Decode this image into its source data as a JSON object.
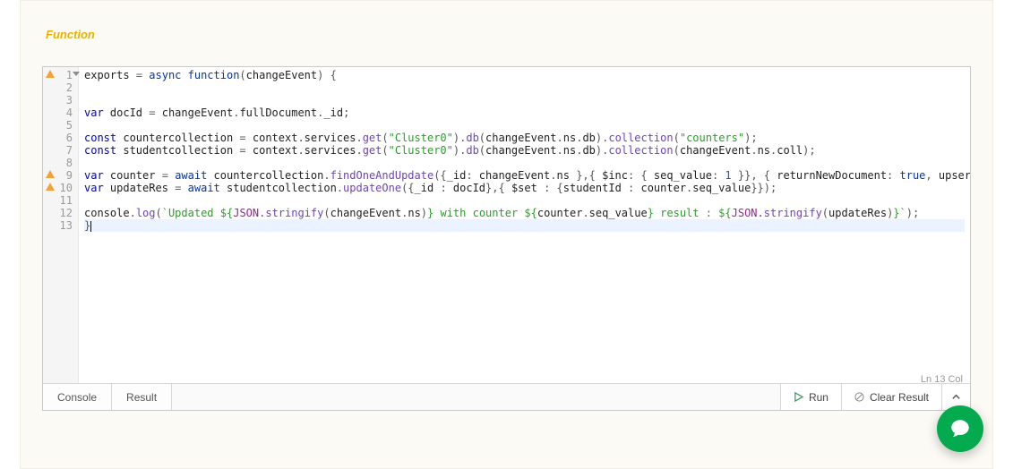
{
  "section_title": "Function",
  "tabs": {
    "console": "Console",
    "result": "Result"
  },
  "buttons": {
    "run": "Run",
    "clear": "Clear Result"
  },
  "status": "Ln 13 Col",
  "editor": {
    "active_line": 13,
    "lines": [
      {
        "n": 1,
        "warn": true,
        "fold": true,
        "tokens": [
          [
            "ident",
            "exports"
          ],
          [
            "op",
            " = "
          ],
          [
            "kw2",
            "async"
          ],
          [
            "ident",
            " "
          ],
          [
            "kw2",
            "function"
          ],
          [
            "punc",
            "("
          ],
          [
            "ident",
            "changeEvent"
          ],
          [
            "punc",
            ")"
          ],
          [
            "ident",
            " "
          ],
          [
            "punc",
            "{"
          ]
        ]
      },
      {
        "n": 2,
        "tokens": []
      },
      {
        "n": 3,
        "tokens": []
      },
      {
        "n": 4,
        "tokens": [
          [
            "storage",
            "var"
          ],
          [
            "ident",
            " docId "
          ],
          [
            "op",
            "="
          ],
          [
            "ident",
            " changeEvent"
          ],
          [
            "punc",
            "."
          ],
          [
            "ident",
            "fullDocument"
          ],
          [
            "punc",
            "."
          ],
          [
            "ident",
            "_id"
          ],
          [
            "punc",
            ";"
          ]
        ]
      },
      {
        "n": 5,
        "tokens": []
      },
      {
        "n": 6,
        "tokens": [
          [
            "storage",
            "const"
          ],
          [
            "ident",
            " countercollection "
          ],
          [
            "op",
            "="
          ],
          [
            "ident",
            " context"
          ],
          [
            "punc",
            "."
          ],
          [
            "ident",
            "services"
          ],
          [
            "punc",
            "."
          ],
          [
            "func",
            "get"
          ],
          [
            "punc",
            "("
          ],
          [
            "str",
            "\"Cluster0\""
          ],
          [
            "punc",
            ")"
          ],
          [
            "punc",
            "."
          ],
          [
            "func",
            "db"
          ],
          [
            "punc",
            "("
          ],
          [
            "ident",
            "changeEvent"
          ],
          [
            "punc",
            "."
          ],
          [
            "ident",
            "ns"
          ],
          [
            "punc",
            "."
          ],
          [
            "ident",
            "db"
          ],
          [
            "punc",
            ")"
          ],
          [
            "punc",
            "."
          ],
          [
            "func",
            "collection"
          ],
          [
            "punc",
            "("
          ],
          [
            "str",
            "\"counters\""
          ],
          [
            "punc",
            ")"
          ],
          [
            "punc",
            ";"
          ]
        ]
      },
      {
        "n": 7,
        "tokens": [
          [
            "storage",
            "const"
          ],
          [
            "ident",
            " studentcollection "
          ],
          [
            "op",
            "="
          ],
          [
            "ident",
            " context"
          ],
          [
            "punc",
            "."
          ],
          [
            "ident",
            "services"
          ],
          [
            "punc",
            "."
          ],
          [
            "func",
            "get"
          ],
          [
            "punc",
            "("
          ],
          [
            "str",
            "\"Cluster0\""
          ],
          [
            "punc",
            ")"
          ],
          [
            "punc",
            "."
          ],
          [
            "func",
            "db"
          ],
          [
            "punc",
            "("
          ],
          [
            "ident",
            "changeEvent"
          ],
          [
            "punc",
            "."
          ],
          [
            "ident",
            "ns"
          ],
          [
            "punc",
            "."
          ],
          [
            "ident",
            "db"
          ],
          [
            "punc",
            ")"
          ],
          [
            "punc",
            "."
          ],
          [
            "func",
            "collection"
          ],
          [
            "punc",
            "("
          ],
          [
            "ident",
            "changeEvent"
          ],
          [
            "punc",
            "."
          ],
          [
            "ident",
            "ns"
          ],
          [
            "punc",
            "."
          ],
          [
            "ident",
            "coll"
          ],
          [
            "punc",
            ")"
          ],
          [
            "punc",
            ";"
          ]
        ]
      },
      {
        "n": 8,
        "tokens": []
      },
      {
        "n": 9,
        "warn": true,
        "tokens": [
          [
            "storage",
            "var"
          ],
          [
            "ident",
            " counter "
          ],
          [
            "op",
            "="
          ],
          [
            "ident",
            " "
          ],
          [
            "kw2",
            "await"
          ],
          [
            "ident",
            " countercollection"
          ],
          [
            "punc",
            "."
          ],
          [
            "func",
            "findOneAndUpdate"
          ],
          [
            "punc",
            "({"
          ],
          [
            "ident",
            "_id"
          ],
          [
            "punc",
            ":"
          ],
          [
            "ident",
            " changeEvent"
          ],
          [
            "punc",
            "."
          ],
          [
            "ident",
            "ns "
          ],
          [
            "punc",
            "},{"
          ],
          [
            "ident",
            " $inc"
          ],
          [
            "punc",
            ":"
          ],
          [
            "punc",
            " {"
          ],
          [
            "ident",
            " seq_value"
          ],
          [
            "punc",
            ":"
          ],
          [
            "num",
            " 1 "
          ],
          [
            "punc",
            "}}"
          ],
          [
            "punc",
            ","
          ],
          [
            "punc",
            " {"
          ],
          [
            "ident",
            " returnNewDocument"
          ],
          [
            "punc",
            ":"
          ],
          [
            "bool",
            " true"
          ],
          [
            "punc",
            ","
          ],
          [
            "ident",
            " upsert "
          ],
          [
            "punc",
            ":"
          ],
          [
            "bool",
            " true"
          ],
          [
            "punc",
            "});"
          ]
        ]
      },
      {
        "n": 10,
        "warn": true,
        "tokens": [
          [
            "storage",
            "var"
          ],
          [
            "ident",
            " updateRes "
          ],
          [
            "op",
            "="
          ],
          [
            "ident",
            " "
          ],
          [
            "kw2",
            "await"
          ],
          [
            "ident",
            " studentcollection"
          ],
          [
            "punc",
            "."
          ],
          [
            "func",
            "updateOne"
          ],
          [
            "punc",
            "({"
          ],
          [
            "ident",
            "_id "
          ],
          [
            "punc",
            ":"
          ],
          [
            "ident",
            " docId"
          ],
          [
            "punc",
            "},{"
          ],
          [
            "ident",
            " $set "
          ],
          [
            "punc",
            ":"
          ],
          [
            "punc",
            " {"
          ],
          [
            "ident",
            "studentId "
          ],
          [
            "punc",
            ":"
          ],
          [
            "ident",
            " counter"
          ],
          [
            "punc",
            "."
          ],
          [
            "ident",
            "seq_value"
          ],
          [
            "punc",
            "}});"
          ]
        ]
      },
      {
        "n": 11,
        "tokens": []
      },
      {
        "n": 12,
        "tokens": [
          [
            "ident",
            "console"
          ],
          [
            "punc",
            "."
          ],
          [
            "func",
            "log"
          ],
          [
            "punc",
            "("
          ],
          [
            "str",
            "`Updated ${"
          ],
          [
            "const",
            "JSON"
          ],
          [
            "punc",
            "."
          ],
          [
            "func",
            "stringify"
          ],
          [
            "punc",
            "("
          ],
          [
            "ident",
            "changeEvent"
          ],
          [
            "punc",
            "."
          ],
          [
            "ident",
            "ns"
          ],
          [
            "punc",
            ")"
          ],
          [
            "str",
            "} with counter ${"
          ],
          [
            "ident",
            "counter"
          ],
          [
            "punc",
            "."
          ],
          [
            "ident",
            "seq_value"
          ],
          [
            "str",
            "} result : ${"
          ],
          [
            "const",
            "JSON"
          ],
          [
            "punc",
            "."
          ],
          [
            "func",
            "stringify"
          ],
          [
            "punc",
            "("
          ],
          [
            "ident",
            "updateRes"
          ],
          [
            "punc",
            ")"
          ],
          [
            "str",
            "}`"
          ],
          [
            "punc",
            ");"
          ]
        ]
      },
      {
        "n": 13,
        "tokens": [
          [
            "punc",
            "}"
          ]
        ]
      }
    ]
  }
}
